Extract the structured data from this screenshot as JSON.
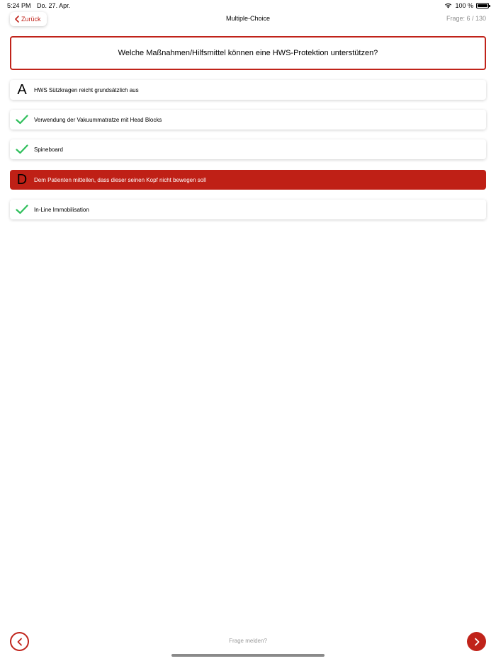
{
  "status_bar": {
    "time": "5:24 PM",
    "date": "Do. 27. Apr.",
    "battery": "100 %"
  },
  "nav": {
    "back_label": "Zurück",
    "title": "Multiple-Choice",
    "counter": "Frage: 6 / 130"
  },
  "question": {
    "text": "Welche Maßnahmen/Hilfsmittel können eine HWS-Protektion unterstützen?"
  },
  "answers": [
    {
      "marker": "A",
      "marker_type": "letter",
      "state": "neutral",
      "text": "HWS Sützkragen reicht grundsätzlich aus"
    },
    {
      "marker": "",
      "marker_type": "check-icon",
      "state": "correct",
      "text": "Verwendung der Vakuummatratze mit Head Blocks"
    },
    {
      "marker": "",
      "marker_type": "check-icon",
      "state": "correct",
      "text": "Spineboard"
    },
    {
      "marker": "D",
      "marker_type": "letter",
      "state": "wrong",
      "text": "Dem Patienten mitteilen, dass dieser seinen Kopf nicht bewegen soll"
    },
    {
      "marker": "",
      "marker_type": "check-icon",
      "state": "correct",
      "text": "In-Line Immobilisation"
    }
  ],
  "footer": {
    "report_label": "Frage melden?"
  },
  "colors": {
    "accent": "#c0231a",
    "wrong_bg": "#bf2016",
    "check": "#2fbf5b",
    "muted_text": "#9a9a9a"
  }
}
